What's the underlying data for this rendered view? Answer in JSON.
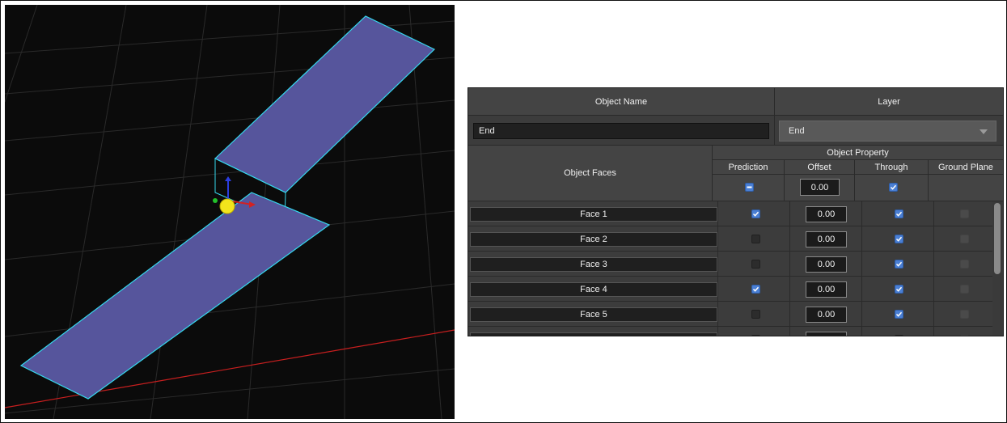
{
  "panel": {
    "headers": {
      "object_name": "Object Name",
      "layer": "Layer",
      "object_faces": "Object Faces",
      "object_property": "Object Property",
      "prediction": "Prediction",
      "offset": "Offset",
      "through": "Through",
      "ground_plane": "Ground Plane"
    },
    "object_name_value": "End",
    "layer_value": "End",
    "header_controls": {
      "prediction": "mixed",
      "offset": "0.00",
      "through": true
    },
    "faces": [
      {
        "name": "Face 1",
        "prediction": true,
        "offset": "0.00",
        "through": true,
        "ground_plane": false
      },
      {
        "name": "Face 2",
        "prediction": false,
        "offset": "0.00",
        "through": true,
        "ground_plane": false
      },
      {
        "name": "Face 3",
        "prediction": false,
        "offset": "0.00",
        "through": true,
        "ground_plane": false
      },
      {
        "name": "Face 4",
        "prediction": true,
        "offset": "0.00",
        "through": true,
        "ground_plane": false
      },
      {
        "name": "Face 5",
        "prediction": false,
        "offset": "0.00",
        "through": true,
        "ground_plane": false
      }
    ]
  },
  "viewport": {
    "background": "#0b0b0b",
    "object_fill": "#56559c",
    "object_edge": "#35d8ee",
    "axis_line_color": "#c81f1f",
    "gizmo_sphere_color": "#f2e51c"
  }
}
